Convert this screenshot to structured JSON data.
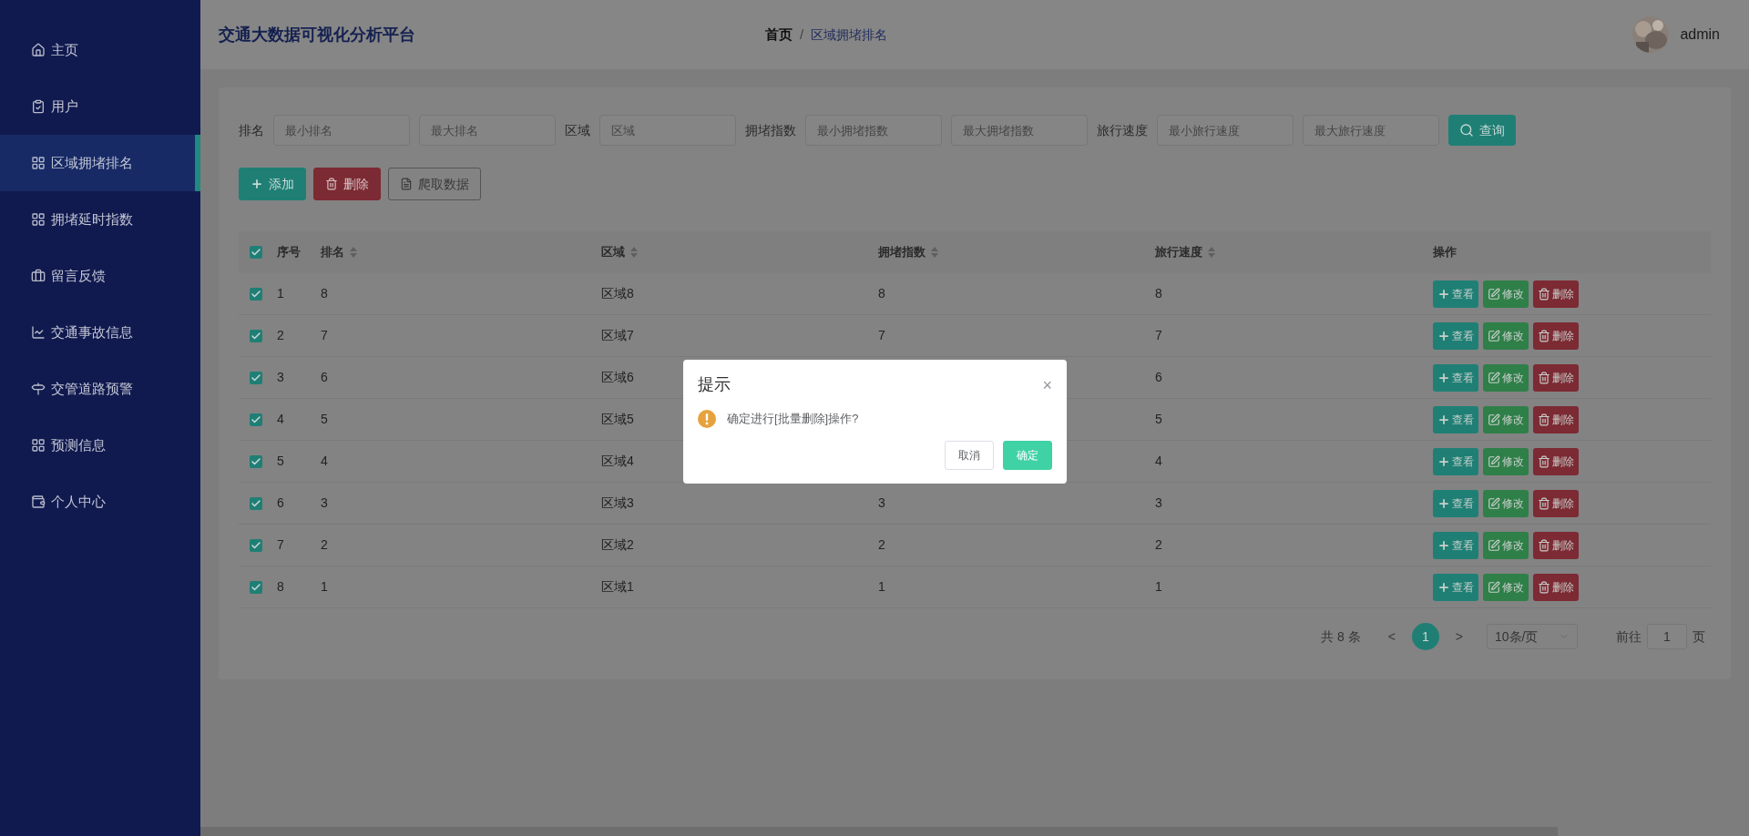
{
  "app_title": "交通大数据可视化分析平台",
  "breadcrumb_separator": "/",
  "breadcrumb": [
    {
      "label": "首页",
      "current": false
    },
    {
      "label": "区域拥堵排名",
      "current": true
    }
  ],
  "user": {
    "name": "admin"
  },
  "sidebar": {
    "items": [
      {
        "label": "主页",
        "selected": false
      },
      {
        "label": "用户",
        "selected": false
      },
      {
        "label": "区域拥堵排名",
        "selected": true
      },
      {
        "label": "拥堵延时指数",
        "selected": false
      },
      {
        "label": "留言反馈",
        "selected": false
      },
      {
        "label": "交通事故信息",
        "selected": false
      },
      {
        "label": "交管道路预警",
        "selected": false
      },
      {
        "label": "预测信息",
        "selected": false
      },
      {
        "label": "个人中心",
        "selected": false
      }
    ]
  },
  "filters": [
    {
      "label": "排名",
      "placeholders": [
        "最小排名",
        "最大排名"
      ]
    },
    {
      "label": "区域",
      "placeholders": [
        "区域"
      ]
    },
    {
      "label": "拥堵指数",
      "placeholders": [
        "最小拥堵指数",
        "最大拥堵指数"
      ]
    },
    {
      "label": "旅行速度",
      "placeholders": [
        "最小旅行速度",
        "最大旅行速度"
      ]
    }
  ],
  "search_button": "查询",
  "actions": [
    {
      "label": "添加",
      "kind": "add"
    },
    {
      "label": "删除",
      "kind": "delete"
    },
    {
      "label": "爬取数据",
      "kind": "crawl"
    }
  ],
  "table": {
    "all_checked": true,
    "columns": [
      {
        "label": "序号",
        "sortable": false
      },
      {
        "label": "排名",
        "sortable": true
      },
      {
        "label": "区域",
        "sortable": true
      },
      {
        "label": "拥堵指数",
        "sortable": true
      },
      {
        "label": "旅行速度",
        "sortable": true
      },
      {
        "label": "操作",
        "sortable": false
      }
    ],
    "rows": [
      {
        "checked": true,
        "cells": [
          "1",
          "8",
          "区域8",
          "8",
          "8"
        ],
        "actions": [
          {
            "label": "查看",
            "kind": "view"
          },
          {
            "label": "修改",
            "kind": "edit"
          },
          {
            "label": "删除",
            "kind": "delete"
          }
        ]
      },
      {
        "checked": true,
        "cells": [
          "2",
          "7",
          "区域7",
          "7",
          "7"
        ],
        "actions": [
          {
            "label": "查看",
            "kind": "view"
          },
          {
            "label": "修改",
            "kind": "edit"
          },
          {
            "label": "删除",
            "kind": "delete"
          }
        ]
      },
      {
        "checked": true,
        "cells": [
          "3",
          "6",
          "区域6",
          "",
          "6"
        ],
        "actions": [
          {
            "label": "查看",
            "kind": "view"
          },
          {
            "label": "修改",
            "kind": "edit"
          },
          {
            "label": "删除",
            "kind": "delete"
          }
        ]
      },
      {
        "checked": true,
        "cells": [
          "4",
          "5",
          "区域5",
          "",
          "5"
        ],
        "actions": [
          {
            "label": "查看",
            "kind": "view"
          },
          {
            "label": "修改",
            "kind": "edit"
          },
          {
            "label": "删除",
            "kind": "delete"
          }
        ]
      },
      {
        "checked": true,
        "cells": [
          "5",
          "4",
          "区域4",
          "",
          "4"
        ],
        "actions": [
          {
            "label": "查看",
            "kind": "view"
          },
          {
            "label": "修改",
            "kind": "edit"
          },
          {
            "label": "删除",
            "kind": "delete"
          }
        ]
      },
      {
        "checked": true,
        "cells": [
          "6",
          "3",
          "区域3",
          "3",
          "3"
        ],
        "actions": [
          {
            "label": "查看",
            "kind": "view"
          },
          {
            "label": "修改",
            "kind": "edit"
          },
          {
            "label": "删除",
            "kind": "delete"
          }
        ]
      },
      {
        "checked": true,
        "cells": [
          "7",
          "2",
          "区域2",
          "2",
          "2"
        ],
        "actions": [
          {
            "label": "查看",
            "kind": "view"
          },
          {
            "label": "修改",
            "kind": "edit"
          },
          {
            "label": "删除",
            "kind": "delete"
          }
        ]
      },
      {
        "checked": true,
        "cells": [
          "8",
          "1",
          "区域1",
          "1",
          "1"
        ],
        "actions": [
          {
            "label": "查看",
            "kind": "view"
          },
          {
            "label": "修改",
            "kind": "edit"
          },
          {
            "label": "删除",
            "kind": "delete"
          }
        ]
      }
    ]
  },
  "pagination": {
    "total": "共 8 条",
    "prev": "<",
    "pages": [
      {
        "label": "1",
        "selected": true
      }
    ],
    "next": ">",
    "page_size": "10条/页",
    "goto_label": "前往",
    "goto_value": "1",
    "goto_suffix": "页"
  },
  "dialog": {
    "title": "提示",
    "close": "×",
    "message": "确定进行[批量删除]操作?",
    "buttons": [
      {
        "label": "取消",
        "kind": "cancel"
      },
      {
        "label": "确定",
        "kind": "confirm"
      }
    ]
  }
}
